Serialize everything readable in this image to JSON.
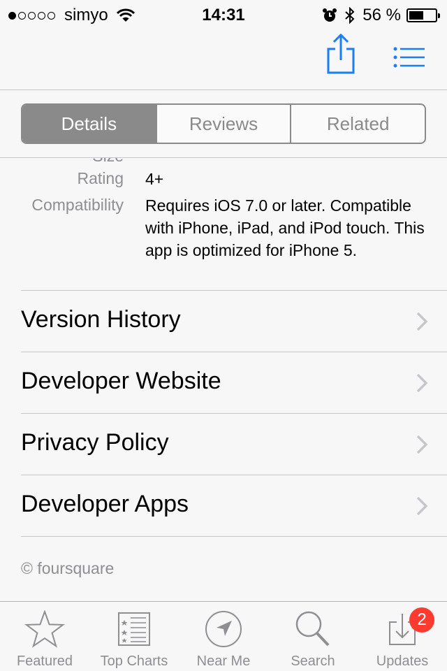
{
  "status_bar": {
    "carrier": "simyo",
    "time": "14:31",
    "battery_percent": "56 %",
    "battery_level": 0.56,
    "signal_bars": 1,
    "signal_total": 5,
    "icons": [
      "wifi-icon",
      "alarm-icon",
      "bluetooth-icon",
      "battery-icon"
    ]
  },
  "nav_bar": {
    "icons": [
      "share-icon",
      "list-icon"
    ],
    "accent_color": "#1a7ef5"
  },
  "segments": [
    {
      "label": "Details",
      "active": true
    },
    {
      "label": "Reviews",
      "active": false
    },
    {
      "label": "Related",
      "active": false
    }
  ],
  "info": {
    "size_label": "Size",
    "size_value": "",
    "rating_label": "Rating",
    "rating_value": "4+",
    "compat_label": "Compatibility",
    "compat_value": "Requires iOS 7.0 or later. Compatible with iPhone, iPad, and iPod touch. This app is optimized for iPhone 5."
  },
  "links": [
    {
      "label": "Version History"
    },
    {
      "label": "Developer Website"
    },
    {
      "label": "Privacy Policy"
    },
    {
      "label": "Developer Apps"
    }
  ],
  "copyright": "© foursquare",
  "tab_bar": {
    "tabs": [
      {
        "label": "Featured",
        "icon": "star-icon"
      },
      {
        "label": "Top Charts",
        "icon": "top-charts-icon"
      },
      {
        "label": "Near Me",
        "icon": "location-arrow-icon"
      },
      {
        "label": "Search",
        "icon": "search-icon"
      },
      {
        "label": "Updates",
        "icon": "updates-icon",
        "badge": "2"
      }
    ],
    "badge_color": "#ff3b30"
  }
}
